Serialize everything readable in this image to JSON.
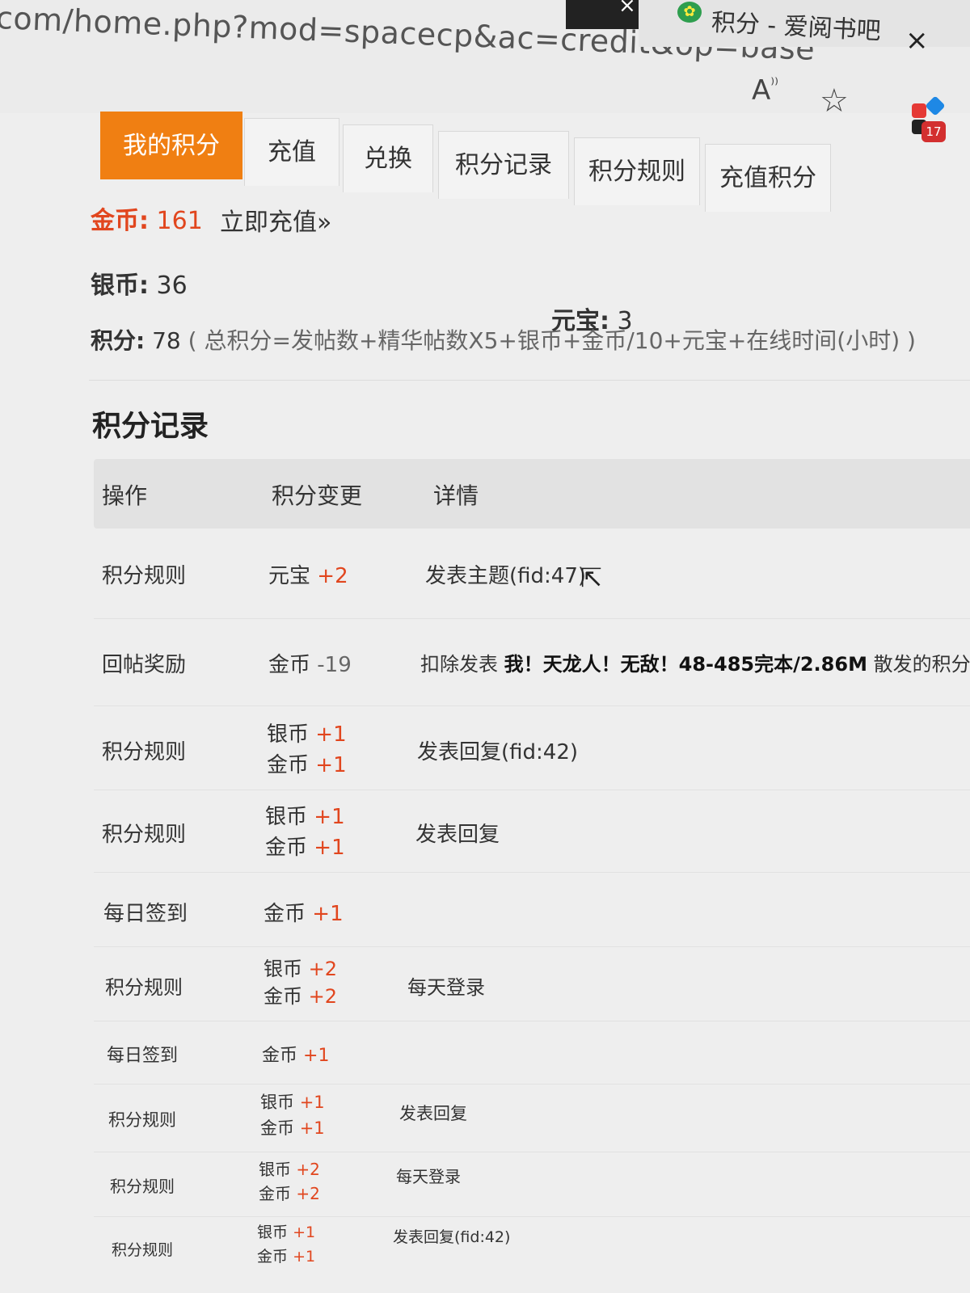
{
  "browser": {
    "url": "com/home.php?mod=spacecp&ac=credit&op=base",
    "tab_title": "积分 - 爱阅书吧",
    "close_tab": "×",
    "read_aloud": "A",
    "favorite": "☆",
    "extensions_badge": "17"
  },
  "tabs": [
    "我的积分",
    "充值",
    "兑换",
    "积分记录",
    "积分规则",
    "充值积分"
  ],
  "active_tab": "我的积分",
  "balance": {
    "gold_label": "金币:",
    "gold_value": "161",
    "recharge_link": "立即充值»",
    "silver_label": "银币:",
    "silver_value": "36",
    "yuanbao_label": "元宝:",
    "yuanbao_value": "3",
    "points_label": "积分:",
    "points_value": "78",
    "points_formula": "( 总积分=发帖数+精华帖数X5+银币+金币/10+元宝+在线时间(小时) )"
  },
  "section_title": "积分记录",
  "table": {
    "headers": [
      "操作",
      "积分变更",
      "详情"
    ],
    "rows": [
      {
        "op": "积分规则",
        "c1n": "元宝",
        "c1v": "+2",
        "c2n": "",
        "c2v": "",
        "detail": "发表主题(fid:47)",
        "detail_bold": "",
        "detail_tail": ""
      },
      {
        "op": "回帖奖励",
        "c1n": "金币",
        "c1v": "-19",
        "c2n": "",
        "c2v": "",
        "detail": "扣除发表 ",
        "detail_bold": "我！天龙人！无敌！48-485完本/2.86M",
        "detail_tail": " 散发的积分"
      },
      {
        "op": "积分规则",
        "c1n": "银币",
        "c1v": "+1",
        "c2n": "金币",
        "c2v": "+1",
        "detail": "发表回复(fid:42)",
        "detail_bold": "",
        "detail_tail": ""
      },
      {
        "op": "积分规则",
        "c1n": "银币",
        "c1v": "+1",
        "c2n": "金币",
        "c2v": "+1",
        "detail": "发表回复",
        "detail_bold": "",
        "detail_tail": ""
      },
      {
        "op": "每日签到",
        "c1n": "金币",
        "c1v": "+1",
        "c2n": "",
        "c2v": "",
        "detail": "",
        "detail_bold": "",
        "detail_tail": ""
      },
      {
        "op": "积分规则",
        "c1n": "银币",
        "c1v": "+2",
        "c2n": "金币",
        "c2v": "+2",
        "detail": "每天登录",
        "detail_bold": "",
        "detail_tail": ""
      },
      {
        "op": "每日签到",
        "c1n": "金币",
        "c1v": "+1",
        "c2n": "",
        "c2v": "",
        "detail": "",
        "detail_bold": "",
        "detail_tail": ""
      },
      {
        "op": "积分规则",
        "c1n": "银币",
        "c1v": "+1",
        "c2n": "金币",
        "c2v": "+1",
        "detail": "发表回复",
        "detail_bold": "",
        "detail_tail": ""
      },
      {
        "op": "积分规则",
        "c1n": "银币",
        "c1v": "+2",
        "c2n": "金币",
        "c2v": "+2",
        "detail": "每天登录",
        "detail_bold": "",
        "detail_tail": ""
      },
      {
        "op": "积分规则",
        "c1n": "银币",
        "c1v": "+1",
        "c2n": "金币",
        "c2v": "+1",
        "detail": "发表回复(fid:42)",
        "detail_bold": "",
        "detail_tail": ""
      }
    ]
  },
  "colors": {
    "accent": "#f07f12",
    "gold_text": "#e1461e"
  }
}
